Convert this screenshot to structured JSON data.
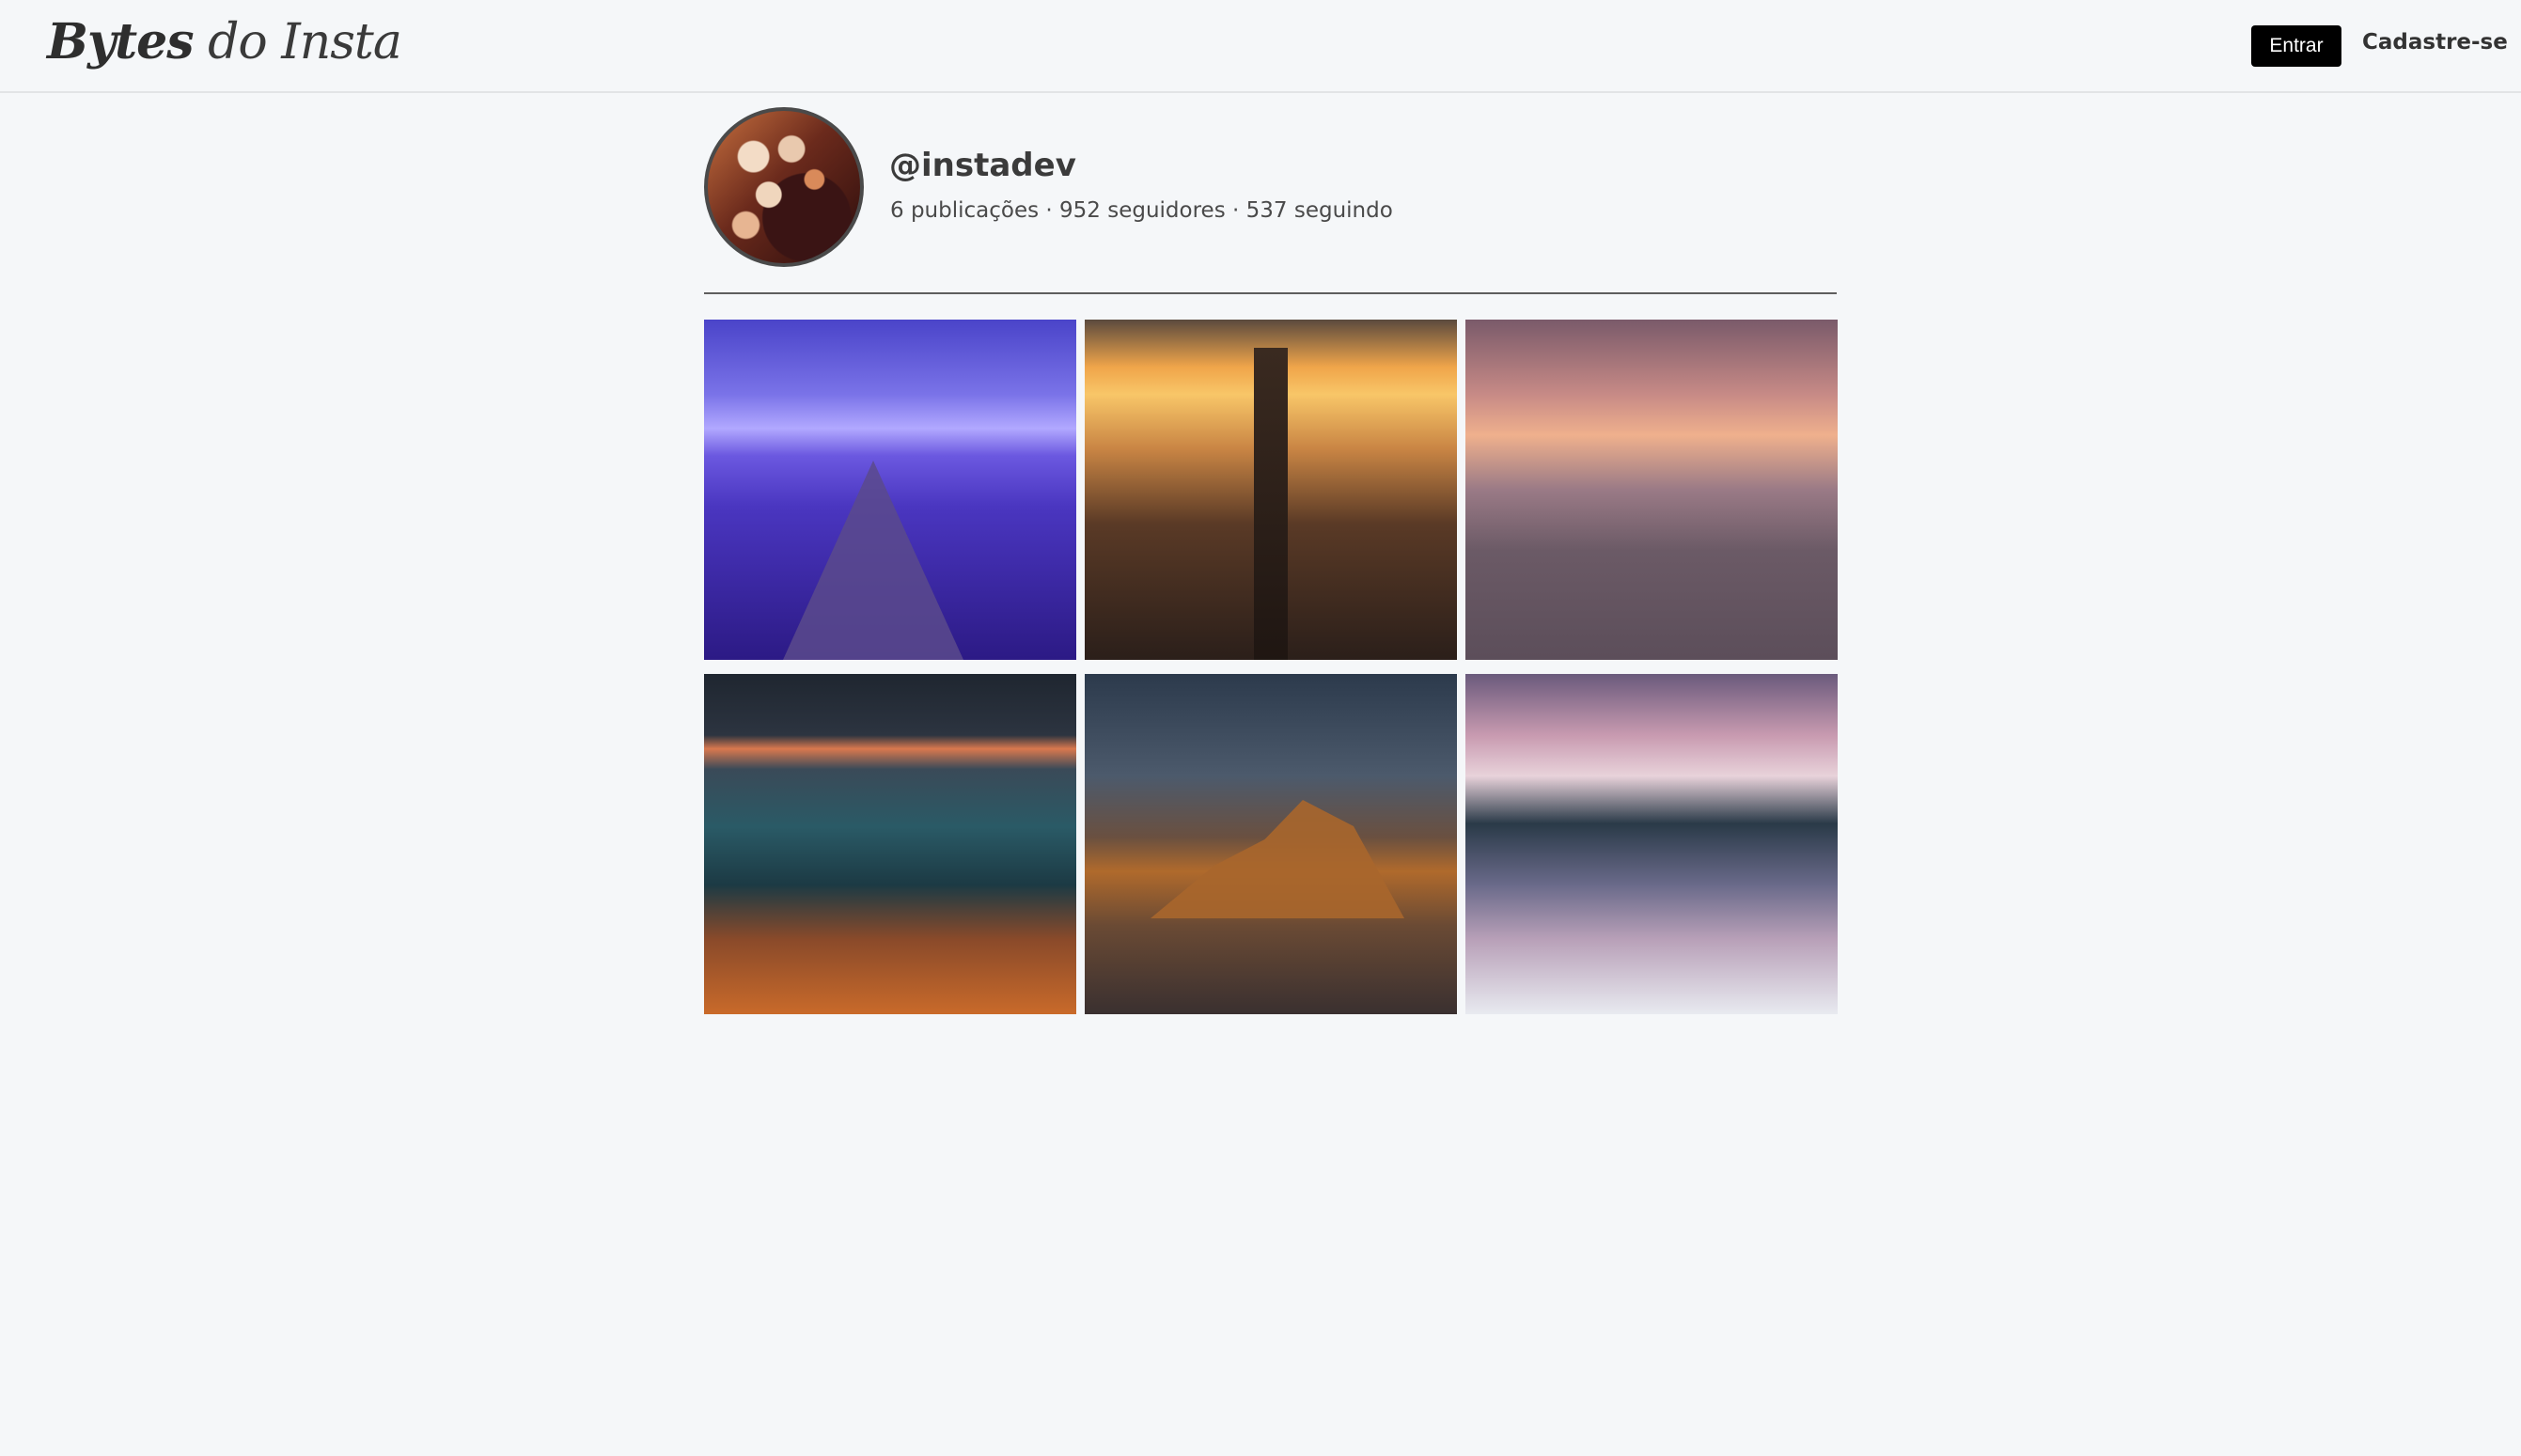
{
  "header": {
    "logo_part1": "Bytes",
    "logo_part2": " do Insta",
    "login_label": "Entrar",
    "signup_label": "Cadastre-se"
  },
  "profile": {
    "username": "@instadev",
    "stats": "6 publicações · 952 seguidores · 537 seguindo"
  },
  "colors": {
    "background": "#f5f7f9",
    "button_bg": "#000000",
    "button_text": "#ffffff"
  }
}
